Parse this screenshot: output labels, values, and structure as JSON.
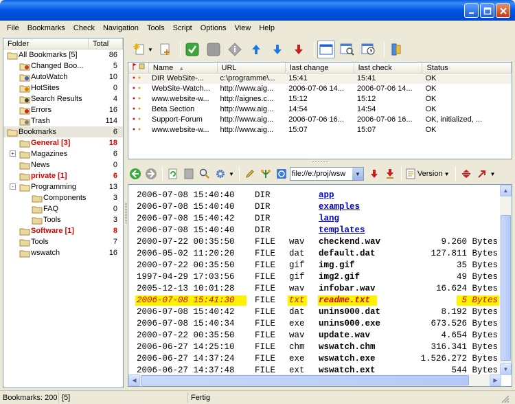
{
  "window": {
    "title": ""
  },
  "menu": [
    "File",
    "Bookmarks",
    "Check",
    "Navigation",
    "Tools",
    "Script",
    "Options",
    "View",
    "Help"
  ],
  "folder_panel": {
    "col_folder": "Folder",
    "col_total": "Total",
    "items": [
      {
        "label": "All Bookmarks  [5]",
        "count": "86",
        "level": 0,
        "icon": "folder-open-icon",
        "red": false
      },
      {
        "label": "Changed Boo...",
        "count": "5",
        "level": 1,
        "icon": "changed-folder-icon",
        "red": false
      },
      {
        "label": "AutoWatch",
        "count": "10",
        "level": 1,
        "icon": "autowatch-folder-icon",
        "red": false
      },
      {
        "label": "HotSites",
        "count": "0",
        "level": 1,
        "icon": "hotsites-folder-icon",
        "red": false
      },
      {
        "label": "Search Results",
        "count": "4",
        "level": 1,
        "icon": "search-folder-icon",
        "red": false
      },
      {
        "label": "Errors",
        "count": "16",
        "level": 1,
        "icon": "errors-folder-icon",
        "red": false
      },
      {
        "label": "Trash",
        "count": "114",
        "level": 1,
        "icon": "trash-folder-icon",
        "red": false
      },
      {
        "label": "Bookmarks",
        "count": "6",
        "level": 0,
        "icon": "folder-open-icon",
        "red": false,
        "selected": true
      },
      {
        "label": "General  [3]",
        "count": "18",
        "level": 1,
        "icon": "folder-icon",
        "red": true
      },
      {
        "label": "Magazines",
        "count": "6",
        "level": 1,
        "icon": "folder-icon",
        "red": false,
        "expander": "+"
      },
      {
        "label": "News",
        "count": "0",
        "level": 1,
        "icon": "folder-icon",
        "red": false
      },
      {
        "label": "private  [1]",
        "count": "6",
        "level": 1,
        "icon": "folder-icon",
        "red": true
      },
      {
        "label": "Programming",
        "count": "13",
        "level": 1,
        "icon": "folder-open-icon",
        "red": false,
        "expander": "-"
      },
      {
        "label": "Components",
        "count": "3",
        "level": 2,
        "icon": "folder-icon",
        "red": false
      },
      {
        "label": "FAQ",
        "count": "0",
        "level": 2,
        "icon": "folder-icon",
        "red": false
      },
      {
        "label": "Tools",
        "count": "3",
        "level": 2,
        "icon": "folder-icon",
        "red": false
      },
      {
        "label": "Software  [1]",
        "count": "8",
        "level": 1,
        "icon": "folder-icon",
        "red": true
      },
      {
        "label": "Tools",
        "count": "7",
        "level": 1,
        "icon": "folder-icon",
        "red": false
      },
      {
        "label": "wswatch",
        "count": "16",
        "level": 1,
        "icon": "folder-icon",
        "red": false
      }
    ]
  },
  "bookmark_table": {
    "columns": [
      "Name",
      "URL",
      "last change",
      "last check",
      "Status"
    ],
    "rows": [
      {
        "name": "DIR  WebSite-...",
        "url": "c:\\programme\\...",
        "last_change": "15:41",
        "last_check": "15:41",
        "status": "OK"
      },
      {
        "name": "WebSite-Watch...",
        "url": "http://www.aig...",
        "last_change": "2006-07-06  14...",
        "last_check": "2006-07-06  14...",
        "status": "OK"
      },
      {
        "name": "www.website-w...",
        "url": "http://aignes.c...",
        "last_change": "15:12",
        "last_check": "15:12",
        "status": "OK"
      },
      {
        "name": "Beta Section",
        "url": "http://www.aig...",
        "last_change": "14:54",
        "last_check": "14:54",
        "status": "OK"
      },
      {
        "name": "Support-Forum",
        "url": "http://www.aig...",
        "last_change": "2006-07-06  16...",
        "last_check": "2006-07-06  16...",
        "status": "OK, initialized, ..."
      },
      {
        "name": "www.website-w...",
        "url": "http://www.aig...",
        "last_change": "15:07",
        "last_check": "15:07",
        "status": "OK"
      }
    ]
  },
  "toolbar2": {
    "address": "file://e:/proj/wsw",
    "version_label": "Version"
  },
  "listing": {
    "rows": [
      {
        "date": "2006-07-08 15:40:40",
        "type": "DIR",
        "ext": "",
        "name": "app",
        "size": "",
        "is_dir": true,
        "highlight": false
      },
      {
        "date": "2006-07-08 15:40:40",
        "type": "DIR",
        "ext": "",
        "name": "examples",
        "size": "",
        "is_dir": true,
        "highlight": false
      },
      {
        "date": "2006-07-08 15:40:42",
        "type": "DIR",
        "ext": "",
        "name": "lang",
        "size": "",
        "is_dir": true,
        "highlight": false
      },
      {
        "date": "2006-07-08 15:40:40",
        "type": "DIR",
        "ext": "",
        "name": "templates",
        "size": "",
        "is_dir": true,
        "highlight": false
      },
      {
        "date": "2000-07-22 00:35:50",
        "type": "FILE",
        "ext": "wav",
        "name": "checkend.wav",
        "size": "9.260 Bytes",
        "is_dir": false,
        "highlight": false
      },
      {
        "date": "2006-05-02 11:20:20",
        "type": "FILE",
        "ext": "dat",
        "name": "default.dat",
        "size": "127.811 Bytes",
        "is_dir": false,
        "highlight": false
      },
      {
        "date": "2000-07-22 00:35:50",
        "type": "FILE",
        "ext": "gif",
        "name": "img.gif",
        "size": "35 Bytes",
        "is_dir": false,
        "highlight": false
      },
      {
        "date": "1997-04-29 17:03:56",
        "type": "FILE",
        "ext": "gif",
        "name": "img2.gif",
        "size": "49 Bytes",
        "is_dir": false,
        "highlight": false
      },
      {
        "date": "2005-12-13 10:01:28",
        "type": "FILE",
        "ext": "wav",
        "name": "infobar.wav",
        "size": "16.624 Bytes",
        "is_dir": false,
        "highlight": false
      },
      {
        "date": "2006-07-08 15:41:30",
        "type": "FILE",
        "ext": "txt",
        "name": "readme.txt",
        "size": "5 Bytes",
        "is_dir": false,
        "highlight": true
      },
      {
        "date": "2006-07-08 15:40:42",
        "type": "FILE",
        "ext": "dat",
        "name": "unins000.dat",
        "size": "8.192 Bytes",
        "is_dir": false,
        "highlight": false
      },
      {
        "date": "2006-07-08 15:40:34",
        "type": "FILE",
        "ext": "exe",
        "name": "unins000.exe",
        "size": "673.526 Bytes",
        "is_dir": false,
        "highlight": false
      },
      {
        "date": "2000-07-22 00:35:50",
        "type": "FILE",
        "ext": "wav",
        "name": "update.wav",
        "size": "4.654 Bytes",
        "is_dir": false,
        "highlight": false
      },
      {
        "date": "2006-06-27 14:25:10",
        "type": "FILE",
        "ext": "chm",
        "name": "wswatch.chm",
        "size": "316.341 Bytes",
        "is_dir": false,
        "highlight": false
      },
      {
        "date": "2006-06-27 14:37:24",
        "type": "FILE",
        "ext": "exe",
        "name": "wswatch.exe",
        "size": "1.526.272 Bytes",
        "is_dir": false,
        "highlight": false
      },
      {
        "date": "2006-06-27 14:37:48",
        "type": "FILE",
        "ext": "ext",
        "name": "wswatch.ext",
        "size": "544 Bytes",
        "is_dir": false,
        "highlight": false
      }
    ]
  },
  "statusbar": {
    "bookmarks": "Bookmarks: 200",
    "changed": "[5]",
    "state": "Fertig"
  },
  "colors": {
    "title_blue": "#0055E5",
    "red_text": "#E00000",
    "highlight_yellow": "#FFF200",
    "link_blue": "#0000CC"
  }
}
